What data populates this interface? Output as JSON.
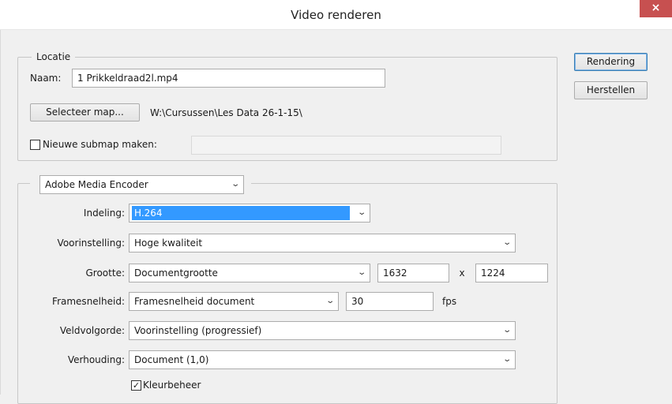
{
  "window": {
    "title": "Video renderen",
    "close": "×"
  },
  "buttons": {
    "render": "Rendering",
    "reset": "Herstellen"
  },
  "location": {
    "legend": "Locatie",
    "name_label": "Naam:",
    "name_value": "1 Prikkeldraad2l.mp4",
    "select_folder": "Selecteer map...",
    "folder_path": "W:\\Cursussen\\Les Data 26-1-15\\",
    "new_subfolder_label": "Nieuwe submap maken:",
    "new_subfolder_checked": false,
    "new_subfolder_value": ""
  },
  "encoder": {
    "type": "Adobe Media Encoder",
    "format_label": "Indeling:",
    "format_value": "H.264",
    "preset_label": "Voorinstelling:",
    "preset_value": "Hoge kwaliteit",
    "size_label": "Grootte:",
    "size_value": "Documentgrootte",
    "width": "1632",
    "times": "x",
    "height": "1224",
    "framerate_label": "Framesnelheid:",
    "framerate_value": "Framesnelheid document",
    "fps_value": "30",
    "fps_unit": "fps",
    "field_order_label": "Veldvolgorde:",
    "field_order_value": "Voorinstelling (progressief)",
    "aspect_label": "Verhouding:",
    "aspect_value": "Document (1,0)",
    "color_mgmt_label": "Kleurbeheer",
    "color_mgmt_checked": true,
    "check_mark": "✓"
  },
  "icons": {
    "dropdown": "chevron-down-icon",
    "checkbox": "checkmark-icon"
  }
}
